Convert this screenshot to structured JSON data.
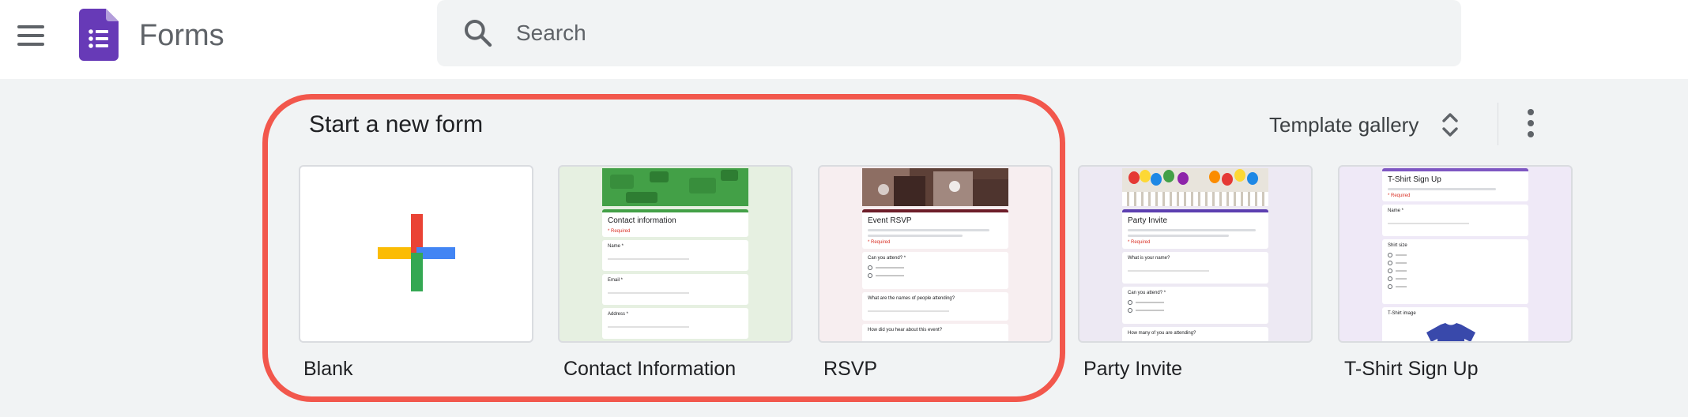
{
  "header": {
    "app_name": "Forms",
    "menu_icon": "hamburger-menu-icon",
    "app_icon": "forms-logo-icon",
    "search": {
      "placeholder": "Search",
      "value": "",
      "icon": "search-icon"
    }
  },
  "templates_section": {
    "title": "Start a new form",
    "gallery_label": "Template gallery",
    "gallery_icon": "unfold-more-icon",
    "more_icon": "more-vert-icon",
    "highlight_color": "#f2574c",
    "items": [
      {
        "label": "Blank",
        "icon": "plus-icon"
      },
      {
        "label": "Contact Information",
        "preview": {
          "title": "Contact information",
          "required": "* Required",
          "questions": [
            "Name *",
            "Email *",
            "Address *"
          ]
        }
      },
      {
        "label": "RSVP",
        "preview": {
          "title": "Event RSVP",
          "required": "* Required",
          "questions": [
            "Can you attend? *",
            "What are the names of people attending?",
            "How did you hear about this event?"
          ]
        }
      },
      {
        "label": "Party Invite",
        "preview": {
          "title": "Party Invite",
          "required": "* Required",
          "questions": [
            "What is your name?",
            "Can you attend? *",
            "How many of you are attending?"
          ]
        }
      },
      {
        "label": "T-Shirt Sign Up",
        "preview": {
          "title": "T-Shirt Sign Up",
          "required": "* Required",
          "questions": [
            "Name *",
            "Shirt size",
            "T-Shirt image"
          ]
        }
      }
    ]
  },
  "colors": {
    "forms_purple": "#673ab7",
    "contact_green": "#43a047",
    "rsvp_maroon": "#6d1d29",
    "party_purple": "#5c3fb0",
    "tshirt_purple": "#7e57c2"
  }
}
